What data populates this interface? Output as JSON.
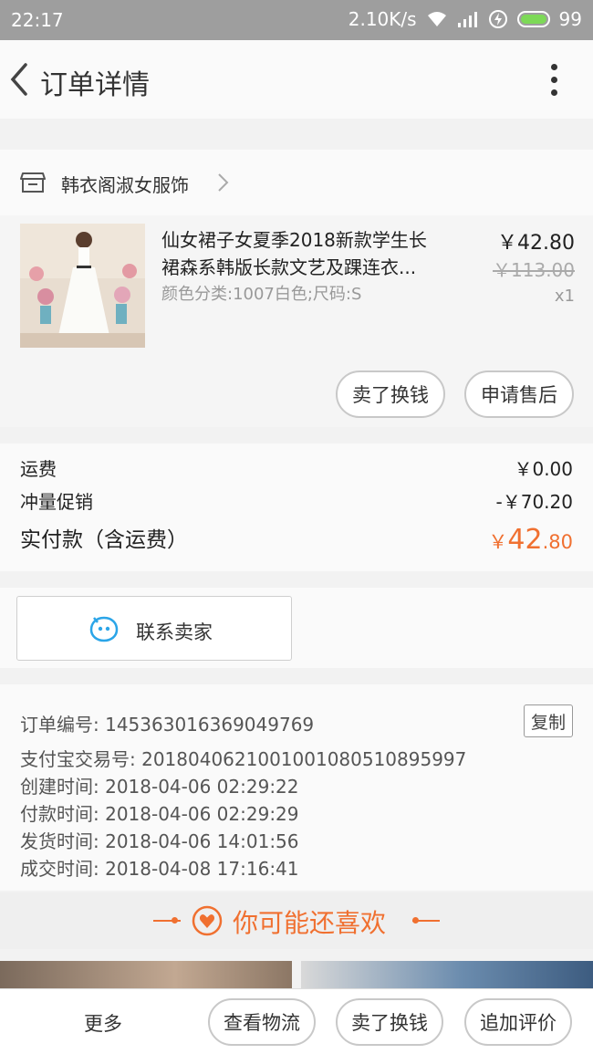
{
  "status_bar": {
    "time": "22:17",
    "network_speed": "2.10K/s",
    "battery": "99"
  },
  "header": {
    "title": "订单详情"
  },
  "shop": {
    "name": "韩衣阁淑女服饰"
  },
  "product": {
    "name_line1": "仙女裙子女夏季2018新款学生长",
    "name_line2": "裙森系韩版长款文艺及踝连衣...",
    "spec": "颜色分类:1007白色;尺码:S",
    "price": "￥42.80",
    "original_price": "￥113.00",
    "quantity": "x1",
    "actions": {
      "cash_out": "卖了换钱",
      "after_sale": "申请售后"
    }
  },
  "totals": {
    "shipping_label": "运费",
    "shipping_value": "￥0.00",
    "promo_label": "冲量促销",
    "promo_value": "-￥70.20",
    "paid_label": "实付款（含运费）",
    "paid_currency": "￥",
    "paid_int": "42",
    "paid_dec": ".80"
  },
  "contact": {
    "label": "联系卖家"
  },
  "order_info": {
    "order_no": "订单编号: 145363016369049769",
    "copy_label": "复制",
    "alipay_no": "支付宝交易号: 2018040621001001080510895997",
    "created": "创建时间: 2018-04-06 02:29:22",
    "paid": "付款时间: 2018-04-06 02:29:29",
    "shipped": "发货时间: 2018-04-06 14:01:56",
    "completed": "成交时间: 2018-04-08 17:16:41"
  },
  "recommend": {
    "label": "你可能还喜欢"
  },
  "bottom_bar": {
    "more": "更多",
    "logistics": "查看物流",
    "cash_out": "卖了换钱",
    "review": "追加评价"
  },
  "colors": {
    "accent": "#f07030",
    "status_bar": "#9e9e9e"
  }
}
